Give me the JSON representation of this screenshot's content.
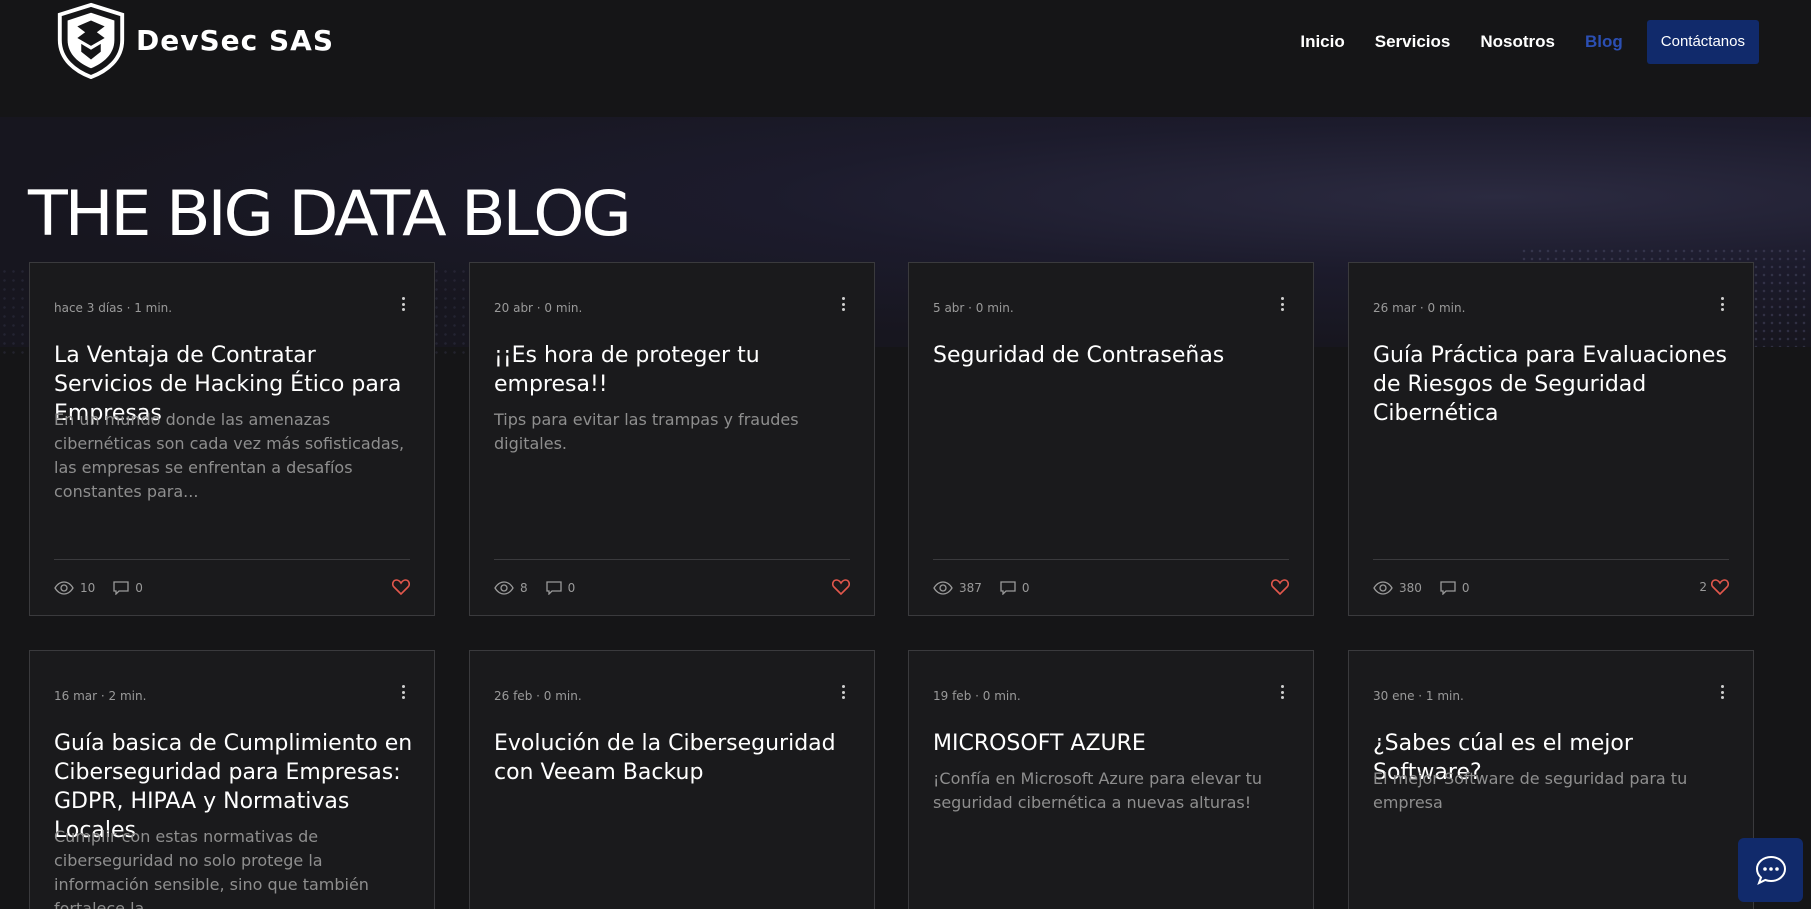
{
  "brand": {
    "name": "DevSec SAS"
  },
  "nav": {
    "items": [
      "Inicio",
      "Servicios",
      "Nosotros",
      "Blog"
    ],
    "cta": "Contáctanos",
    "active": "Blog",
    "active_color": "#2b4fb3"
  },
  "page": {
    "title": "THE BIG DATA BLOG"
  },
  "posts": [
    {
      "meta": "hace 3 días · 1 min.",
      "title": "La Ventaja de Contratar Servicios de Hacking Ético para Empresas",
      "excerpt": "En un mundo donde las amenazas cibernéticas son cada vez más sofisticadas, las empresas se enfrentan a desafíos constantes para...",
      "views": "10",
      "comments": "0",
      "likes": ""
    },
    {
      "meta": "20 abr · 0 min.",
      "title": "¡¡Es hora de proteger tu empresa!!",
      "excerpt": "Tips para evitar las trampas y fraudes digitales.",
      "views": "8",
      "comments": "0",
      "likes": ""
    },
    {
      "meta": "5 abr · 0 min.",
      "title": "Seguridad de Contraseñas",
      "excerpt": "",
      "views": "387",
      "comments": "0",
      "likes": ""
    },
    {
      "meta": "26 mar · 0 min.",
      "title": "Guía Práctica para Evaluaciones de Riesgos de Seguridad Cibernética",
      "excerpt": "",
      "views": "380",
      "comments": "0",
      "likes": "2"
    },
    {
      "meta": "16 mar · 2 min.",
      "title": "Guía basica de Cumplimiento en Ciberseguridad para Empresas: GDPR, HIPAA y Normativas Locales",
      "excerpt": "Cumplir con estas normativas de ciberseguridad no solo protege la información sensible, sino que también fortalece la...",
      "views": "",
      "comments": "",
      "likes": ""
    },
    {
      "meta": "26 feb · 0 min.",
      "title": "Evolución de la Ciberseguridad con Veeam Backup",
      "excerpt": "",
      "views": "",
      "comments": "",
      "likes": ""
    },
    {
      "meta": "19 feb · 0 min.",
      "title": "MICROSOFT AZURE",
      "excerpt": "¡Confía en Microsoft Azure para elevar tu seguridad cibernética a nuevas alturas!",
      "views": "",
      "comments": "",
      "likes": ""
    },
    {
      "meta": "30 ene · 1 min.",
      "title": "¿Sabes cúal es el mejor Software?",
      "excerpt": "El mejor Software de seguridad para tu empresa",
      "views": "",
      "comments": "",
      "likes": ""
    }
  ],
  "colors": {
    "background": "#151517",
    "card": "#1a1a1c",
    "heart": "#e2574c",
    "cta": "#112a6b"
  },
  "icons": {
    "chat": "chat-bubble-icon",
    "logo": "shield-logo-icon"
  }
}
